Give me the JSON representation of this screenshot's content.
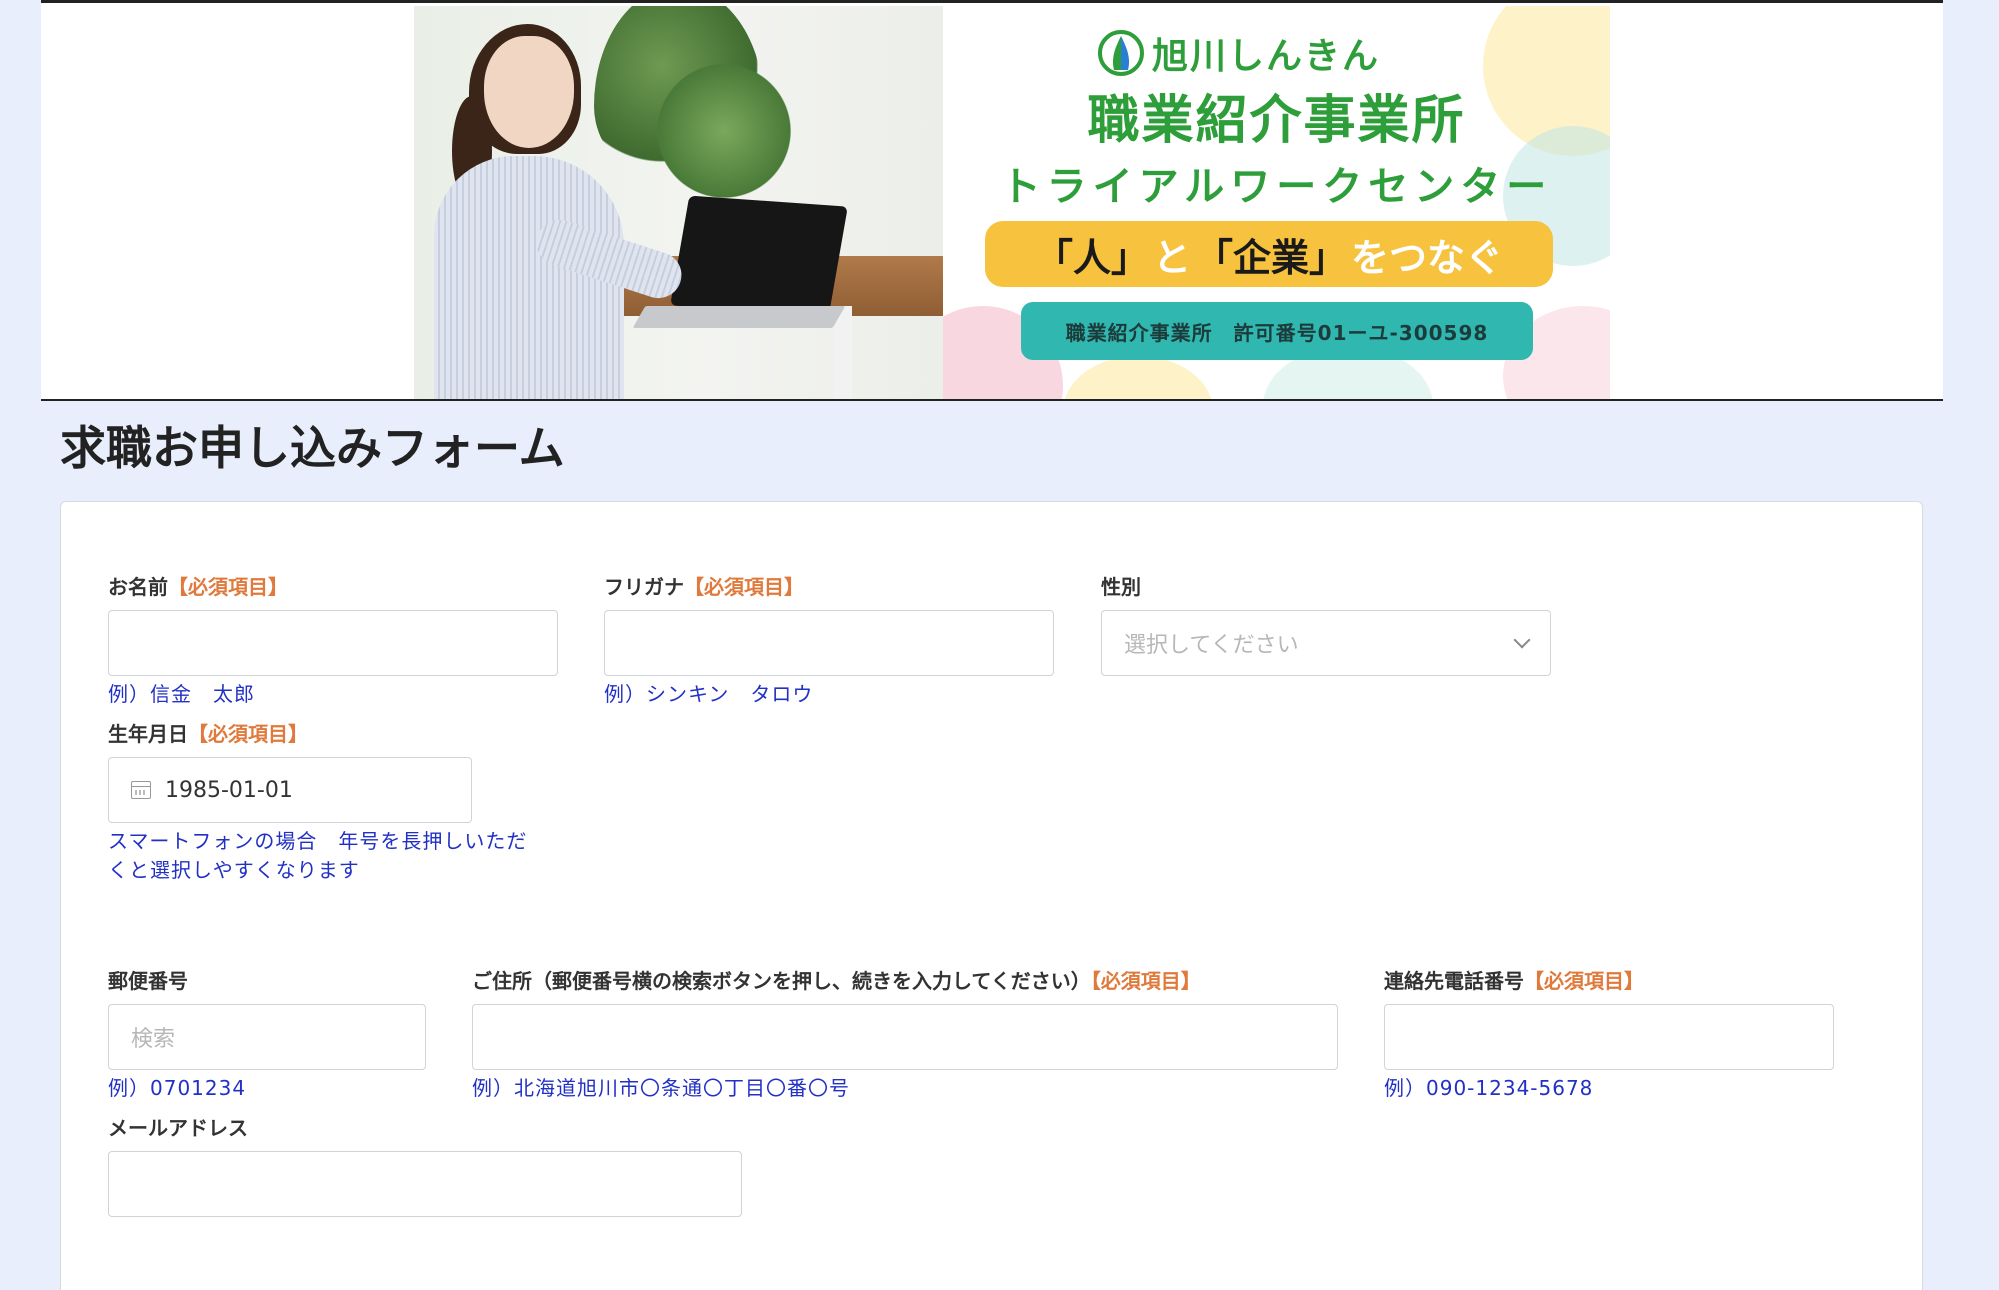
{
  "banner": {
    "brand_name": "旭川しんきん",
    "title_main": "職業紹介事業所",
    "title_sub": "トライアルワークセンター",
    "tagline": {
      "part1": "「人」",
      "part2": "と",
      "part3": "「企業」",
      "part4": "をつなぐ"
    },
    "license": "職業紹介事業所　許可番号01ーユ-300598"
  },
  "page_title": "求職お申し込みフォーム",
  "required_mark": "【必須項目】",
  "form": {
    "name": {
      "label": "お名前",
      "value": "",
      "hint": "例）信金　太郎"
    },
    "furigana": {
      "label": "フリガナ",
      "value": "",
      "hint": "例）シンキン　タロウ"
    },
    "gender": {
      "label": "性別",
      "placeholder": "選択してください"
    },
    "birthdate": {
      "label": "生年月日",
      "value": "1985-01-01",
      "hint_line1": "スマートフォンの場合　年号を長押しいただ",
      "hint_line2": "くと選択しやすくなります"
    },
    "postal": {
      "label": "郵便番号",
      "placeholder": "検索",
      "hint": "例）0701234"
    },
    "address": {
      "label": "ご住所（郵便番号横の検索ボタンを押し、続きを入力してください）",
      "value": "",
      "hint": "例）北海道旭川市〇条通〇丁目〇番〇号"
    },
    "phone": {
      "label": "連絡先電話番号",
      "value": "",
      "hint": "例）090-1234-5678"
    },
    "email": {
      "label": "メールアドレス",
      "value": ""
    }
  },
  "colors": {
    "background": "#e8eefc",
    "required": "#e07a3c",
    "hint": "#2230c6",
    "brand_green": "#2e9e3a",
    "tagline_yellow": "#f7c23e",
    "license_teal": "#2fb7b0"
  }
}
